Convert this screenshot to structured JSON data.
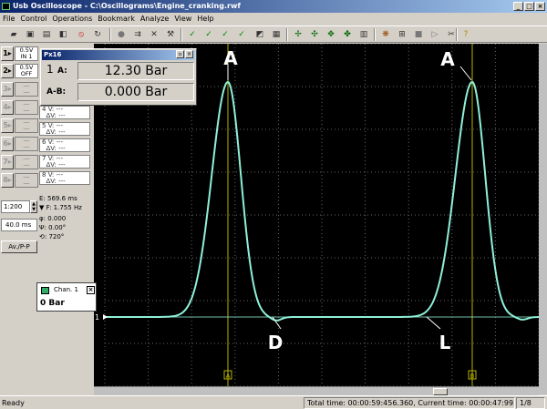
{
  "app": {
    "title": "Usb Oscilloscope - C:\\Oscillograms\\Engine_cranking.rwf",
    "minimize": "_",
    "maximize": "□",
    "close": "×"
  },
  "menu": [
    "File",
    "Control",
    "Operations",
    "Bookmark",
    "Analyze",
    "View",
    "Help"
  ],
  "toolbar_icons": [
    "open-folder-icon",
    "save-icon",
    "print-icon",
    "record-icon",
    "stop-icon",
    "rewind-icon",
    "run-icon",
    "measure-icon",
    "tools-icon",
    "check-icon",
    "check-icon",
    "check-icon",
    "check-icon",
    "color-icon",
    "grid-icon",
    "cursor-icon",
    "cursor-icon",
    "cursor-icon",
    "cursor-icon",
    "cursor-icon",
    "settings-icon",
    "settings-icon",
    "settings-icon",
    "stop-icon",
    "cut-icon",
    "help-icon"
  ],
  "channels": [
    {
      "num": "1",
      "volts": "0.5V",
      "sub": "IN 1",
      "active": true
    },
    {
      "num": "2",
      "volts": "0.5V",
      "sub": "OFF",
      "active": true
    },
    {
      "num": "3",
      "volts": "---",
      "sub": "---",
      "active": false
    },
    {
      "num": "4",
      "volts": "---",
      "sub": "---",
      "active": false
    },
    {
      "num": "5",
      "volts": "---",
      "sub": "---",
      "active": false
    },
    {
      "num": "6",
      "volts": "---",
      "sub": "---",
      "active": false
    },
    {
      "num": "7",
      "volts": "---",
      "sub": "---",
      "active": false
    },
    {
      "num": "8",
      "volts": "---",
      "sub": "---",
      "active": false
    }
  ],
  "vlist": [
    {
      "num": "4",
      "v": "V:",
      "val": "---",
      "dv": "ΔV:",
      "dval": "---"
    },
    {
      "num": "5",
      "v": "V:",
      "val": "---",
      "dv": "ΔV:",
      "dval": "---"
    },
    {
      "num": "6",
      "v": "V:",
      "val": "---",
      "dv": "ΔV:",
      "dval": "---"
    },
    {
      "num": "7",
      "v": "V:",
      "val": "---",
      "dv": "ΔV:",
      "dval": "---"
    },
    {
      "num": "8",
      "v": "V:",
      "val": "---",
      "dv": "ΔV:",
      "dval": "---"
    }
  ],
  "timebase": {
    "ratio": "1:200",
    "time": "40.0 ms"
  },
  "measure": {
    "e": "E: 569.6 ms",
    "f": "▼ F: 1.755 Hz",
    "phi1": "φ: 0.000",
    "phi2": "Ψ: 0.00°",
    "deg": "⟲: 720°"
  },
  "avpp": "Av./P-P",
  "px_window": {
    "title": "Px16",
    "channel": "1",
    "a_label": "A:",
    "a_value": "12.30 Bar",
    "ab_label": "A-B:",
    "ab_value": "0.000 Bar"
  },
  "legend": {
    "name": "Chan. 1",
    "value": "0 Bar"
  },
  "annotations": {
    "a1": "A",
    "a2": "A",
    "d": "D",
    "l": "L"
  },
  "cursors": {
    "a": "A",
    "b": "B"
  },
  "zero_marker": "1",
  "status": {
    "ready": "Ready",
    "total": "Total time: 00:00:59:456.360,  Current time: 00:00:47:993.600",
    "page": "1/8"
  },
  "colors": {
    "trace": "#8ff0d8",
    "grid": "#6a6a6a",
    "cursor": "#b9b400"
  }
}
